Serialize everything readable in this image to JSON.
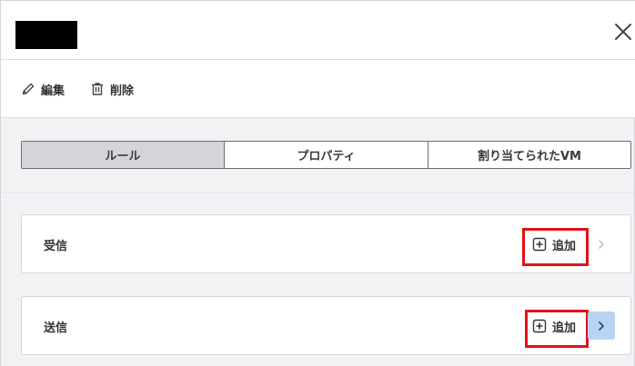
{
  "toolbar": {
    "edit_label": "編集",
    "delete_label": "削除"
  },
  "tabs": [
    {
      "label": "ルール",
      "active": true
    },
    {
      "label": "プロパティ",
      "active": false
    },
    {
      "label": "割り当てられたVM",
      "active": false
    }
  ],
  "sections": [
    {
      "title": "受信",
      "add_label": "追加"
    },
    {
      "title": "送信",
      "add_label": "追加"
    }
  ],
  "colors": {
    "highlight": "#e0121b",
    "active_tab": "#d3d5d8",
    "chevron_active_bg": "#b9d3f2"
  }
}
